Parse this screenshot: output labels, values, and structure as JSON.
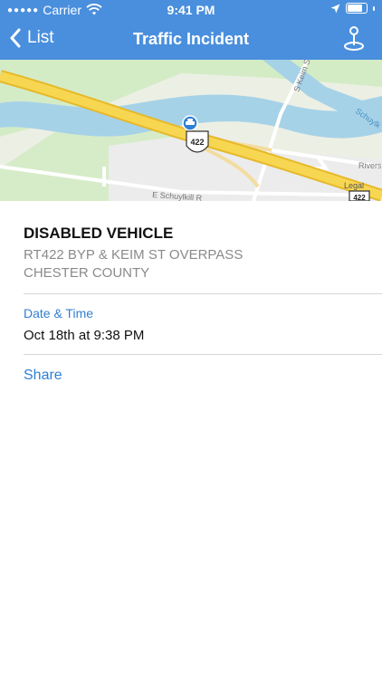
{
  "status_bar": {
    "carrier": "Carrier",
    "time": "9:41 PM"
  },
  "nav": {
    "back_label": "List",
    "title": "Traffic Incident"
  },
  "map": {
    "route_shield": "422",
    "route_shield_2": "422",
    "street_keim": "S Keim St",
    "street_rivers": "Rivers",
    "street_schuylkill": "E Schuylkill R",
    "river_label": "Schuylk",
    "legal": "Legal"
  },
  "incident": {
    "type": "DISABLED VEHICLE",
    "location_line1": "RT422 BYP & KEIM ST OVERPASS",
    "location_line2": "CHESTER COUNTY",
    "datetime_label": "Date & Time",
    "datetime_value": "Oct 18th at 9:38 PM",
    "share_label": "Share"
  },
  "colors": {
    "header": "#4a8fdd",
    "accent": "#2f7fd4"
  }
}
